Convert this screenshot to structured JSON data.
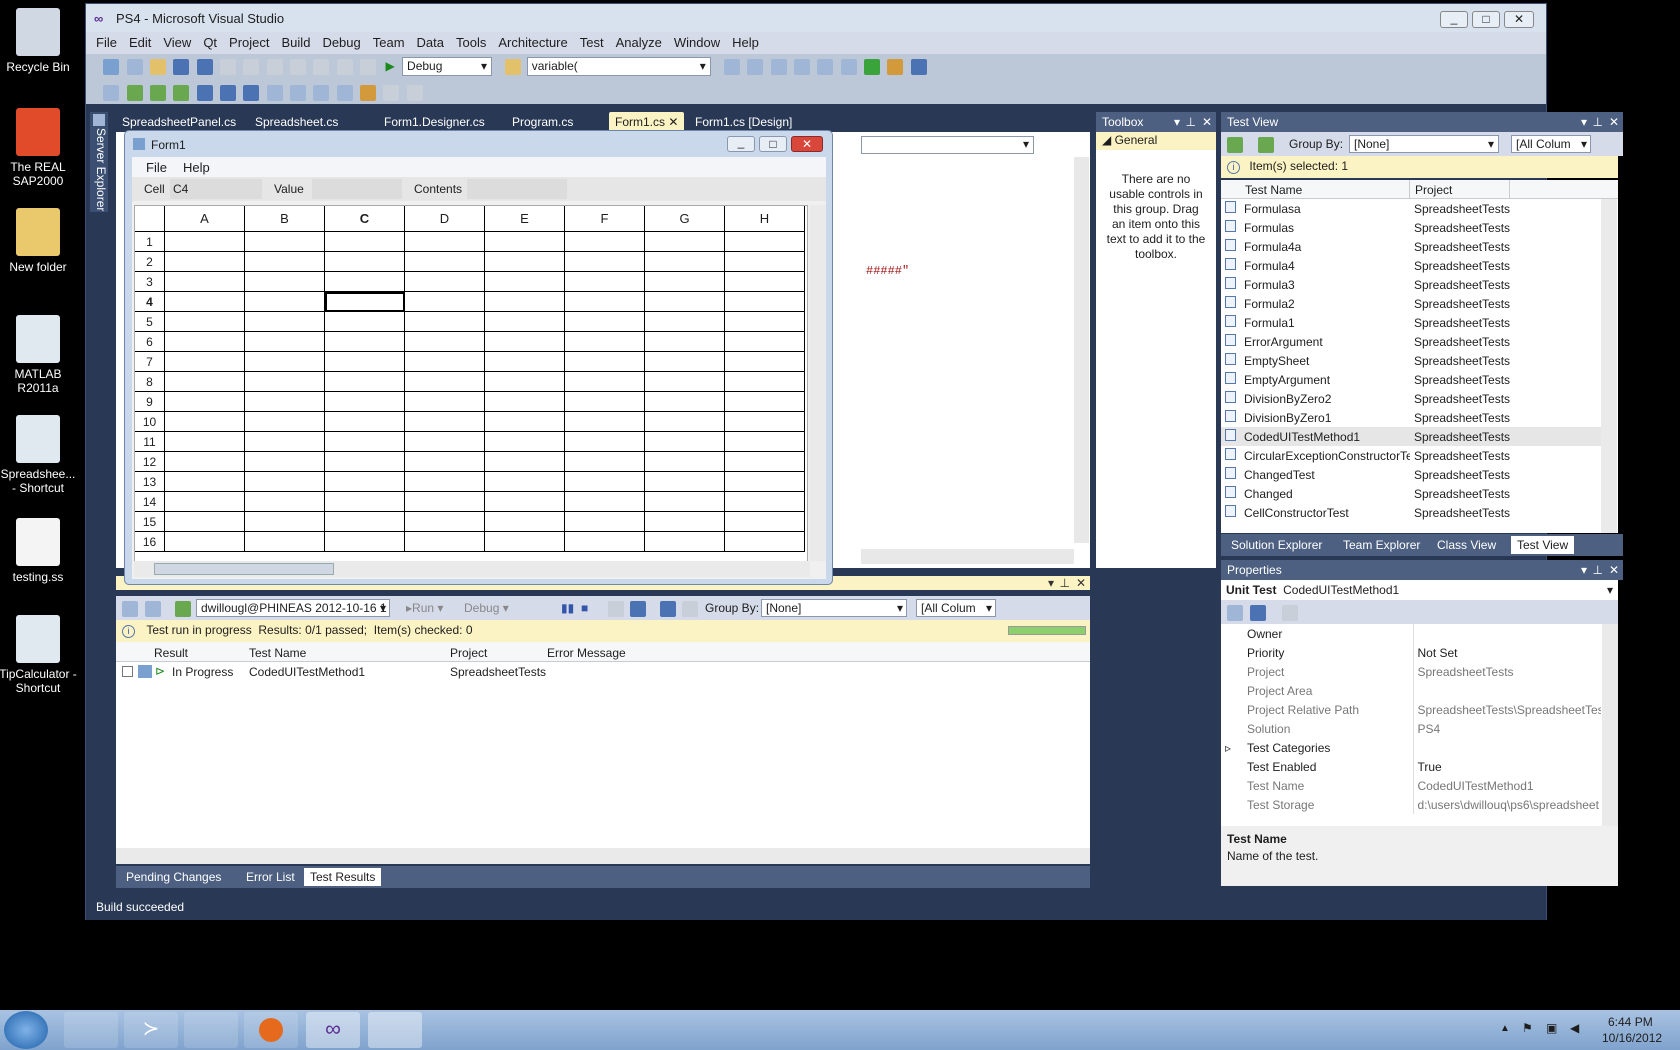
{
  "desktop": {
    "icons": [
      {
        "label": "Recycle Bin",
        "name": "recycle-bin-icon"
      },
      {
        "label": "The REAL SAP2000",
        "name": "sap2000-icon"
      },
      {
        "label": "New folder",
        "name": "folder-icon"
      },
      {
        "label": "MATLAB R2011a",
        "name": "matlab-shortcut-icon"
      },
      {
        "label": "Spreadshee... - Shortcut",
        "name": "spreadsheet-shortcut-icon"
      },
      {
        "label": "testing.ss",
        "name": "file-icon"
      },
      {
        "label": "TipCalculator - Shortcut",
        "name": "tipcalculator-shortcut-icon"
      }
    ]
  },
  "vs": {
    "title": "PS4 - Microsoft Visual Studio",
    "menu": [
      "File",
      "Edit",
      "View",
      "Qt",
      "Project",
      "Build",
      "Debug",
      "Team",
      "Data",
      "Tools",
      "Architecture",
      "Test",
      "Analyze",
      "Window",
      "Help"
    ],
    "config": "Debug",
    "find_text": "variable(",
    "server_explorer": "Server Explorer",
    "doc_tabs": [
      "SpreadsheetPanel.cs",
      "Spreadsheet.cs",
      "Form1.Designer.cs",
      "Program.cs",
      "Form1.cs",
      "Form1.cs [Design]"
    ],
    "code_snippet": "#####\"",
    "status": "Build succeeded"
  },
  "form1": {
    "title": "Form1",
    "menu": [
      "File",
      "Help"
    ],
    "cell_label": "Cell",
    "cell_value": "C4",
    "value_label": "Value",
    "contents_label": "Contents",
    "columns": [
      "A",
      "B",
      "C",
      "D",
      "E",
      "F",
      "G",
      "H"
    ],
    "rows": [
      "1",
      "2",
      "3",
      "4",
      "5",
      "6",
      "7",
      "8",
      "9",
      "10",
      "11",
      "12",
      "13",
      "14",
      "15",
      "16"
    ]
  },
  "toolbox": {
    "title": "Toolbox",
    "group": "General",
    "message": "There are no usable controls in this group. Drag an item onto this text to add it to the toolbox."
  },
  "test_view": {
    "title": "Test View",
    "group_by_label": "Group By:",
    "group_by_value": "[None]",
    "columns_filter": "[All Colum",
    "selected": "Item(s) selected: 1",
    "col_name": "Test Name",
    "col_project": "Project",
    "rows": [
      {
        "name": "Formulasa",
        "project": "SpreadsheetTests"
      },
      {
        "name": "Formulas",
        "project": "SpreadsheetTests"
      },
      {
        "name": "Formula4a",
        "project": "SpreadsheetTests"
      },
      {
        "name": "Formula4",
        "project": "SpreadsheetTests"
      },
      {
        "name": "Formula3",
        "project": "SpreadsheetTests"
      },
      {
        "name": "Formula2",
        "project": "SpreadsheetTests"
      },
      {
        "name": "Formula1",
        "project": "SpreadsheetTests"
      },
      {
        "name": "ErrorArgument",
        "project": "SpreadsheetTests"
      },
      {
        "name": "EmptySheet",
        "project": "SpreadsheetTests"
      },
      {
        "name": "EmptyArgument",
        "project": "SpreadsheetTests"
      },
      {
        "name": "DivisionByZero2",
        "project": "SpreadsheetTests"
      },
      {
        "name": "DivisionByZero1",
        "project": "SpreadsheetTests"
      },
      {
        "name": "CodedUITestMethod1",
        "project": "SpreadsheetTests"
      },
      {
        "name": "CircularExceptionConstructorTe",
        "project": "SpreadsheetTests"
      },
      {
        "name": "ChangedTest",
        "project": "SpreadsheetTests"
      },
      {
        "name": "Changed",
        "project": "SpreadsheetTests"
      },
      {
        "name": "CellConstructorTest",
        "project": "SpreadsheetTests"
      }
    ],
    "bottom_tabs": [
      "Solution Explorer",
      "Team Explorer",
      "Class View",
      "Test View"
    ]
  },
  "properties": {
    "title": "Properties",
    "object": "Unit Test",
    "object_name": "CodedUITestMethod1",
    "rows": [
      {
        "k": "Owner",
        "v": ""
      },
      {
        "k": "Priority",
        "v": "Not Set"
      },
      {
        "k": "Project",
        "v": "SpreadsheetTests"
      },
      {
        "k": "Project Area",
        "v": ""
      },
      {
        "k": "Project Relative Path",
        "v": "SpreadsheetTests\\SpreadsheetTest:"
      },
      {
        "k": "Solution",
        "v": "PS4"
      },
      {
        "k": "Test Categories",
        "v": ""
      },
      {
        "k": "Test Enabled",
        "v": "True"
      },
      {
        "k": "Test Name",
        "v": "CodedUITestMethod1"
      },
      {
        "k": "Test Storage",
        "v": "d:\\users\\dwillouq\\ps6\\spreadsheet"
      }
    ],
    "desc_title": "Test Name",
    "desc_text": "Name of the test."
  },
  "test_results": {
    "run": "dwillougl@PHINEAS 2012-10-16 1",
    "run_label": "Run",
    "debug_label": "Debug",
    "group_by_label": "Group By:",
    "group_by_value": "[None]",
    "columns_filter": "[All Colum",
    "status": "Test run in progress  Results: 0/1 passed;  Item(s) checked: 0",
    "headers": [
      "Result",
      "Test Name",
      "Project",
      "Error Message"
    ],
    "row": {
      "result": "In Progress",
      "name": "CodedUITestMethod1",
      "project": "SpreadsheetTests",
      "error": ""
    },
    "bottom_tabs": [
      "Pending Changes",
      "Error List",
      "Test Results"
    ]
  },
  "taskbar": {
    "time": "6:44 PM",
    "date": "10/16/2012"
  }
}
